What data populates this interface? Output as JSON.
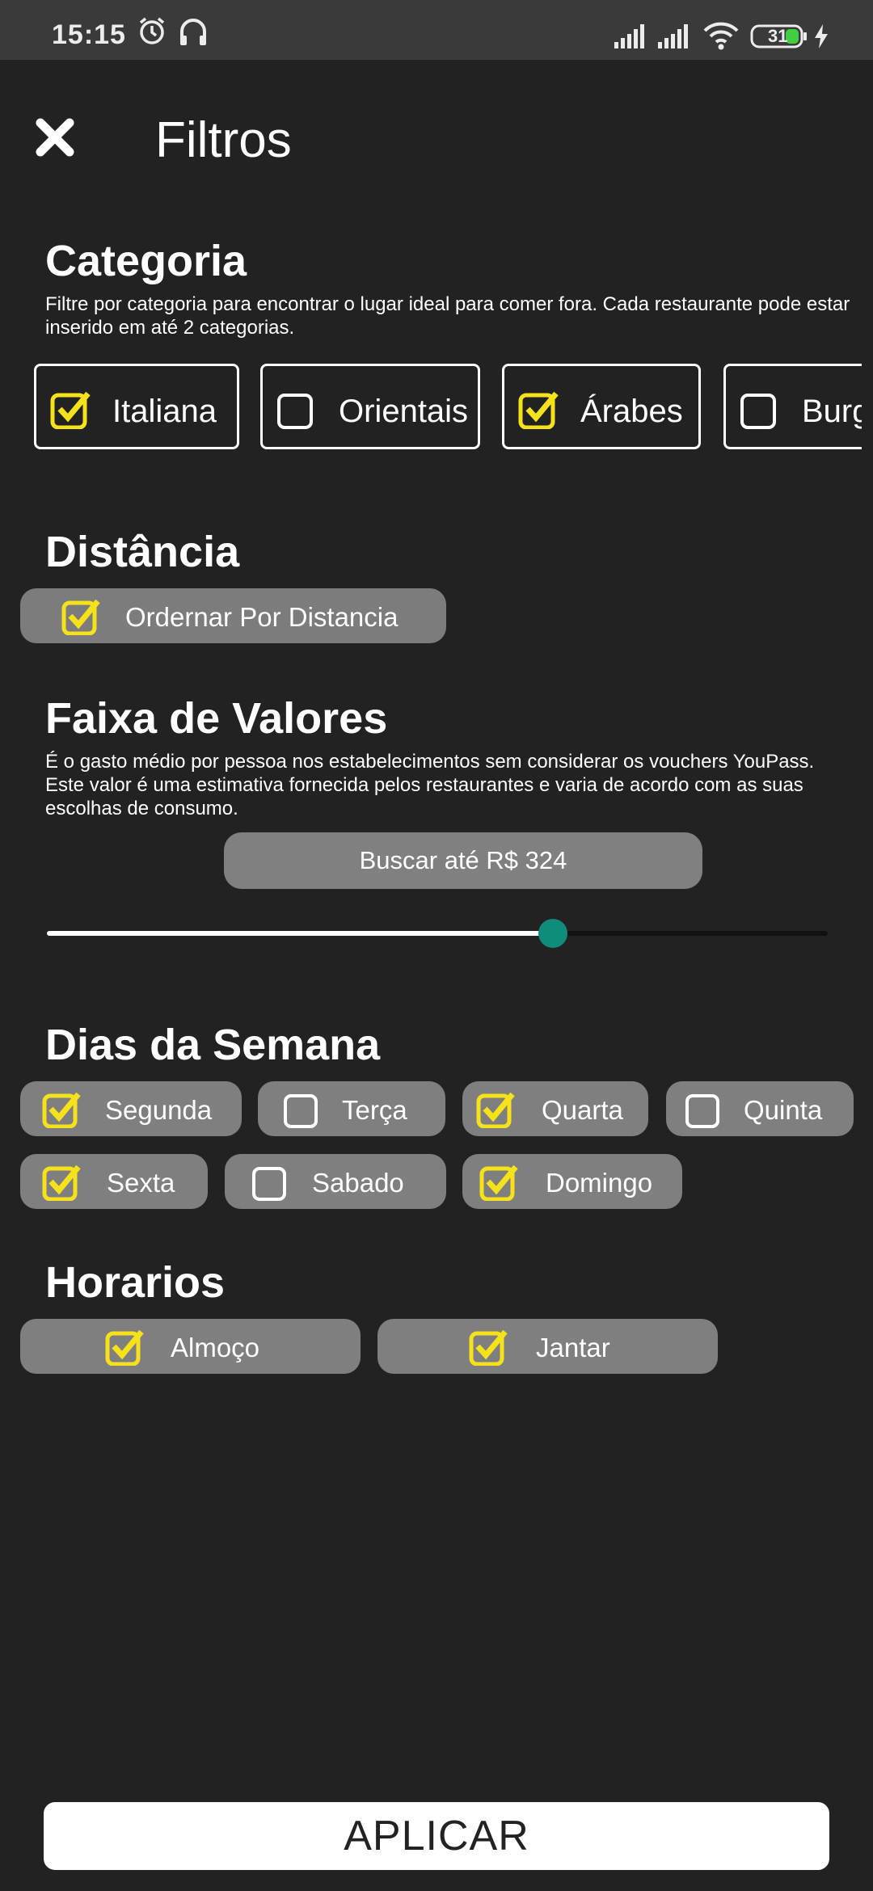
{
  "status_bar": {
    "time": "15:15",
    "battery": "31",
    "icons": [
      "alarm-icon",
      "headphones-icon",
      "signal-icon",
      "signal-icon",
      "wifi-icon",
      "battery-icon",
      "charging-icon"
    ]
  },
  "header": {
    "title": "Filtros",
    "close_icon": "close-icon"
  },
  "colors": {
    "background": "#222222",
    "pill": "#7f7f7f",
    "checkbox_checked": "#f5e21b",
    "slider_thumb": "#0e8d7d",
    "apply_button": "#ffffff"
  },
  "categoria": {
    "title": "Categoria",
    "description": "Filtre por categoria para encontrar o lugar ideal para comer fora. Cada restaurante pode estar inserido em até 2 categorias.",
    "items": [
      {
        "label": "Italiana",
        "checked": true
      },
      {
        "label": "Orientais",
        "checked": false
      },
      {
        "label": "Árabes",
        "checked": true
      },
      {
        "label": "Burg",
        "checked": false
      }
    ]
  },
  "distancia": {
    "title": "Distância",
    "option": {
      "label": "Ordernar Por Distancia",
      "checked": true
    }
  },
  "faixa": {
    "title": "Faixa de Valores",
    "description": "É o gasto médio por pessoa nos estabelecimentos sem considerar os vouchers YouPass. Este valor é uma estimativa fornecida pelos restaurantes e varia de acordo com as suas escolhas de consumo.",
    "button_label": "Buscar até R$ 324",
    "slider_fraction": 0.648
  },
  "dias": {
    "title": "Dias da Semana",
    "items": [
      {
        "label": "Segunda",
        "checked": true
      },
      {
        "label": "Terça",
        "checked": false
      },
      {
        "label": "Quarta",
        "checked": true
      },
      {
        "label": "Quinta",
        "checked": false
      },
      {
        "label": "Sexta",
        "checked": true
      },
      {
        "label": "Sabado",
        "checked": false
      },
      {
        "label": "Domingo",
        "checked": true
      }
    ]
  },
  "horarios": {
    "title": "Horarios",
    "items": [
      {
        "label": "Almoço",
        "checked": true
      },
      {
        "label": "Jantar",
        "checked": true
      }
    ]
  },
  "footer": {
    "apply_label": "APLICAR"
  }
}
